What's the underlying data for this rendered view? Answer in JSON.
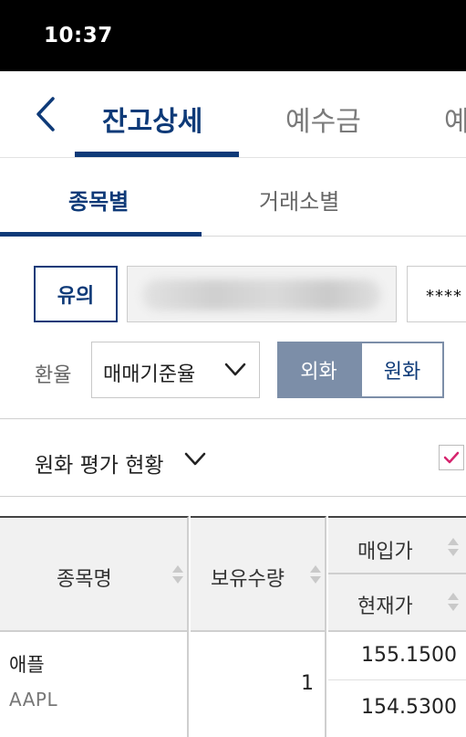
{
  "status_bar": {
    "time": "10:37"
  },
  "nav": {
    "tabs": [
      {
        "label": "잔고상세",
        "active": true
      },
      {
        "label": "예수금",
        "active": false
      },
      {
        "label": "예수",
        "active": false
      }
    ]
  },
  "sub_tabs": [
    {
      "label": "종목별",
      "active": true
    },
    {
      "label": "거래소별",
      "active": false
    }
  ],
  "account": {
    "notice_label": "유의",
    "password_mask": "****"
  },
  "exchange": {
    "label": "환율",
    "selected": "매매기준율",
    "toggle": [
      {
        "label": "외화",
        "selected": true
      },
      {
        "label": "원화",
        "selected": false
      }
    ]
  },
  "summary": {
    "label": "원화 평가 현황",
    "checked": true
  },
  "holdings": {
    "headers": {
      "name": "종목명",
      "quantity": "보유수량",
      "buy_price": "매입가",
      "current_price": "현재가"
    },
    "rows": [
      {
        "name": "애플",
        "ticker": "AAPL",
        "quantity": "1",
        "buy_price": "155.1500",
        "current_price": "154.5300"
      }
    ]
  },
  "colors": {
    "primary": "#0e3a78",
    "toggle_active": "#7c8ea8",
    "check": "#d6246e"
  }
}
